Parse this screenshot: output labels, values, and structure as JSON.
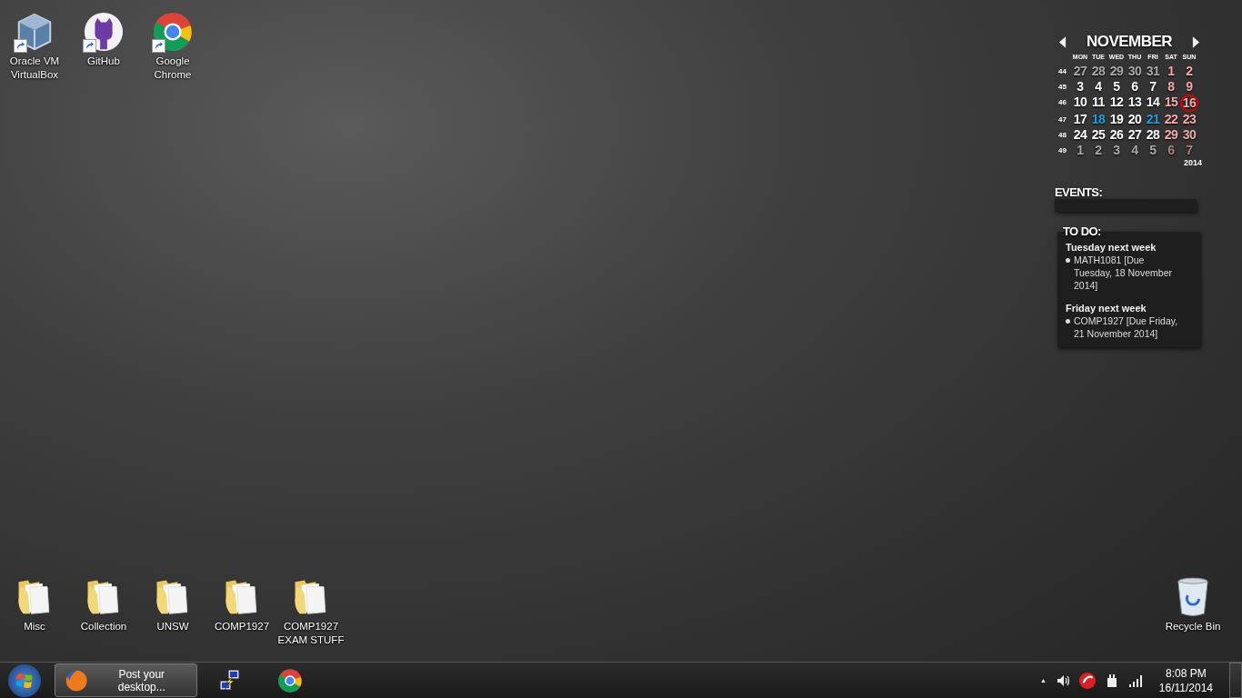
{
  "desktop_icons_top": [
    {
      "label": "Oracle VM VirtualBox",
      "kind": "virtualbox",
      "shortcut": true
    },
    {
      "label": "GitHub",
      "kind": "github",
      "shortcut": true
    },
    {
      "label": "Google Chrome",
      "kind": "chrome",
      "shortcut": true
    }
  ],
  "desktop_icons_bottom": [
    {
      "label": "Misc",
      "kind": "folder"
    },
    {
      "label": "Collection",
      "kind": "folder"
    },
    {
      "label": "UNSW",
      "kind": "folder"
    },
    {
      "label": "COMP1927",
      "kind": "folder"
    },
    {
      "label": "COMP1927 EXAM STUFF",
      "kind": "folder"
    }
  ],
  "recycle_bin": {
    "label": "Recycle Bin"
  },
  "calendar": {
    "month": "NOVEMBER",
    "year": "2014",
    "weekdays": [
      "MON",
      "TUE",
      "WED",
      "THU",
      "FRI",
      "SAT",
      "SUN"
    ],
    "weeks": [
      {
        "number": "44",
        "days": [
          {
            "d": "27",
            "kind": "other"
          },
          {
            "d": "28",
            "kind": "other"
          },
          {
            "d": "29",
            "kind": "other"
          },
          {
            "d": "30",
            "kind": "other"
          },
          {
            "d": "31",
            "kind": "other"
          },
          {
            "d": "1",
            "kind": "weekend"
          },
          {
            "d": "2",
            "kind": "weekend"
          }
        ]
      },
      {
        "number": "45",
        "days": [
          {
            "d": "3",
            "kind": "day"
          },
          {
            "d": "4",
            "kind": "day"
          },
          {
            "d": "5",
            "kind": "day"
          },
          {
            "d": "6",
            "kind": "day"
          },
          {
            "d": "7",
            "kind": "day"
          },
          {
            "d": "8",
            "kind": "weekend"
          },
          {
            "d": "9",
            "kind": "weekend"
          }
        ]
      },
      {
        "number": "46",
        "days": [
          {
            "d": "10",
            "kind": "day"
          },
          {
            "d": "11",
            "kind": "day"
          },
          {
            "d": "12",
            "kind": "day"
          },
          {
            "d": "13",
            "kind": "day"
          },
          {
            "d": "14",
            "kind": "day"
          },
          {
            "d": "15",
            "kind": "weekend"
          },
          {
            "d": "16",
            "kind": "today"
          }
        ]
      },
      {
        "number": "47",
        "days": [
          {
            "d": "17",
            "kind": "day"
          },
          {
            "d": "18",
            "kind": "event"
          },
          {
            "d": "19",
            "kind": "day"
          },
          {
            "d": "20",
            "kind": "day"
          },
          {
            "d": "21",
            "kind": "event"
          },
          {
            "d": "22",
            "kind": "weekend"
          },
          {
            "d": "23",
            "kind": "weekend"
          }
        ]
      },
      {
        "number": "48",
        "days": [
          {
            "d": "24",
            "kind": "day"
          },
          {
            "d": "25",
            "kind": "day"
          },
          {
            "d": "26",
            "kind": "day"
          },
          {
            "d": "27",
            "kind": "day"
          },
          {
            "d": "28",
            "kind": "day"
          },
          {
            "d": "29",
            "kind": "weekend"
          },
          {
            "d": "30",
            "kind": "weekend"
          }
        ]
      },
      {
        "number": "49",
        "days": [
          {
            "d": "1",
            "kind": "other"
          },
          {
            "d": "2",
            "kind": "other"
          },
          {
            "d": "3",
            "kind": "other"
          },
          {
            "d": "4",
            "kind": "other"
          },
          {
            "d": "5",
            "kind": "other"
          },
          {
            "d": "6",
            "kind": "other-weekend"
          },
          {
            "d": "7",
            "kind": "other-weekend"
          }
        ]
      }
    ]
  },
  "events": {
    "title": "EVENTS:"
  },
  "todo": {
    "title": "TO DO:",
    "groups": [
      {
        "heading": "Tuesday next week",
        "items": [
          "MATH1081 [Due Tuesday, 18 November 2014]"
        ]
      },
      {
        "heading": "Friday next week",
        "items": [
          "COMP1927 [Due Friday, 21 November 2014]"
        ]
      }
    ]
  },
  "taskbar": {
    "tasks": [
      {
        "kind": "firefox",
        "label": "Post your desktop...",
        "open": true
      },
      {
        "kind": "putty",
        "open": false
      },
      {
        "kind": "chrome",
        "open": false
      }
    ],
    "tray_arrow": "▲",
    "time": "8:08 PM",
    "date": "16/11/2014"
  }
}
